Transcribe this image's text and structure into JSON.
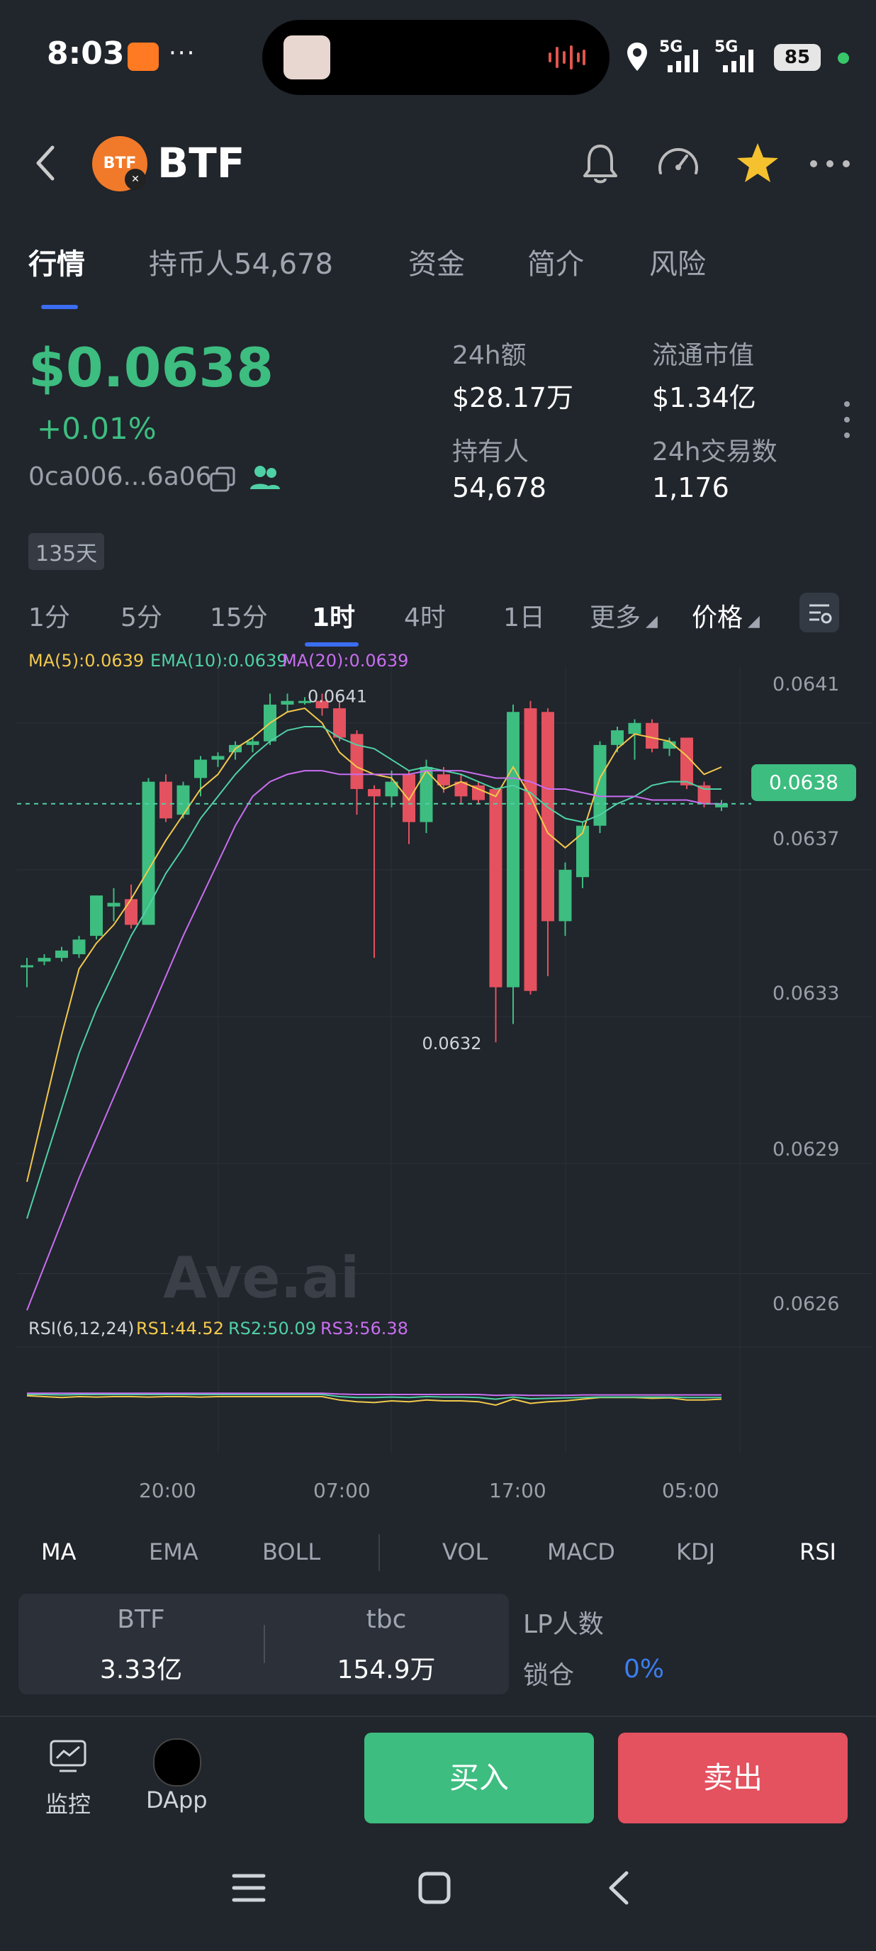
{
  "status_bar": {
    "time": "8:03",
    "battery": "85",
    "network1": "5G",
    "network2": "5G"
  },
  "token": {
    "symbol": "BTF"
  },
  "tabs": [
    {
      "label": "行情",
      "active": true
    },
    {
      "label": "持币人54,678"
    },
    {
      "label": "资金"
    },
    {
      "label": "简介"
    },
    {
      "label": "风险"
    }
  ],
  "price": {
    "value": "$0.0638",
    "change": "+0.01%",
    "address": "0ca006...6a06"
  },
  "stats": {
    "vol24h_label": "24h额",
    "vol24h": "$28.17万",
    "mcap_label": "流通市值",
    "mcap": "$1.34亿",
    "holders_label": "持有人",
    "holders": "54,678",
    "tx24h_label": "24h交易数",
    "tx24h": "1,176"
  },
  "age_badge": "135天",
  "timeframes": [
    "1分",
    "5分",
    "15分",
    "1时",
    "4时",
    "1日"
  ],
  "timeframe_active": "1时",
  "more_label": "更多",
  "price_mode": "价格",
  "ma_legend": {
    "ma5": "MA(5):0.0639",
    "ma10": "EMA(10):0.0639",
    "ma20": "MA(20):0.0639"
  },
  "ma_colors": {
    "ma5": "#f2c94c",
    "ma10": "#4fd1a5",
    "ma20": "#c86ef0"
  },
  "watermark": "Ave.ai",
  "current_price_tag": "0.0638",
  "high_label": "0.0641",
  "low_label": "0.0632",
  "rsi_legend": {
    "name": "RSI(6,12,24)",
    "rs1": "RS1:44.52",
    "rs2": "RS2:50.09",
    "rs3": "RS3:56.38"
  },
  "indicator_tabs": [
    "MA",
    "EMA",
    "BOLL",
    "VOL",
    "MACD",
    "KDJ",
    "RSI"
  ],
  "pool": {
    "token_label": "BTF",
    "token_amount": "3.33亿",
    "quote_label": "tbc",
    "quote_amount": "154.9万",
    "lp_label": "LP人数",
    "lock_label": "锁仓",
    "lock_value": "0%"
  },
  "bottom_nav": {
    "monitor": "监控",
    "dapp": "DApp",
    "buy": "买入",
    "sell": "卖出"
  },
  "chart_data": {
    "type": "candlestick",
    "y_ticks": [
      "0.0641",
      "0.0637",
      "0.0633",
      "0.0629",
      "0.0626"
    ],
    "x_ticks": [
      "20:00",
      "07:00",
      "17:00",
      "05:00"
    ],
    "ylim": [
      0.0624,
      0.0642
    ],
    "candles": [
      {
        "o": 0.06344,
        "h": 0.06346,
        "l": 0.06338,
        "c": 0.06344
      },
      {
        "o": 0.06345,
        "h": 0.06347,
        "l": 0.06344,
        "c": 0.06346
      },
      {
        "o": 0.06346,
        "h": 0.06349,
        "l": 0.06345,
        "c": 0.06348
      },
      {
        "o": 0.06347,
        "h": 0.06352,
        "l": 0.06346,
        "c": 0.06351
      },
      {
        "o": 0.06352,
        "h": 0.06363,
        "l": 0.06351,
        "c": 0.06363
      },
      {
        "o": 0.0636,
        "h": 0.06365,
        "l": 0.06356,
        "c": 0.06361
      },
      {
        "o": 0.06362,
        "h": 0.06366,
        "l": 0.06354,
        "c": 0.06355
      },
      {
        "o": 0.06355,
        "h": 0.06395,
        "l": 0.06355,
        "c": 0.06394
      },
      {
        "o": 0.06394,
        "h": 0.06396,
        "l": 0.06383,
        "c": 0.06384
      },
      {
        "o": 0.06385,
        "h": 0.06394,
        "l": 0.06384,
        "c": 0.06393
      },
      {
        "o": 0.06395,
        "h": 0.06401,
        "l": 0.0639,
        "c": 0.064
      },
      {
        "o": 0.064,
        "h": 0.06402,
        "l": 0.06398,
        "c": 0.06401
      },
      {
        "o": 0.06402,
        "h": 0.06405,
        "l": 0.064,
        "c": 0.06404
      },
      {
        "o": 0.06404,
        "h": 0.06406,
        "l": 0.06402,
        "c": 0.06405
      },
      {
        "o": 0.06405,
        "h": 0.06418,
        "l": 0.06404,
        "c": 0.06415
      },
      {
        "o": 0.06415,
        "h": 0.06418,
        "l": 0.06413,
        "c": 0.06416
      },
      {
        "o": 0.06416,
        "h": 0.06417,
        "l": 0.06415,
        "c": 0.06416
      },
      {
        "o": 0.06416,
        "h": 0.06418,
        "l": 0.06412,
        "c": 0.06414
      },
      {
        "o": 0.06414,
        "h": 0.06416,
        "l": 0.06405,
        "c": 0.06406
      },
      {
        "o": 0.06407,
        "h": 0.06408,
        "l": 0.06385,
        "c": 0.06392
      },
      {
        "o": 0.06392,
        "h": 0.06393,
        "l": 0.06346,
        "c": 0.0639
      },
      {
        "o": 0.0639,
        "h": 0.06397,
        "l": 0.06387,
        "c": 0.06394
      },
      {
        "o": 0.06396,
        "h": 0.06397,
        "l": 0.06377,
        "c": 0.06383
      },
      {
        "o": 0.06383,
        "h": 0.064,
        "l": 0.0638,
        "c": 0.06398
      },
      {
        "o": 0.06396,
        "h": 0.06398,
        "l": 0.06391,
        "c": 0.06393
      },
      {
        "o": 0.06394,
        "h": 0.06396,
        "l": 0.06388,
        "c": 0.0639
      },
      {
        "o": 0.06393,
        "h": 0.06394,
        "l": 0.06388,
        "c": 0.06389
      },
      {
        "o": 0.06392,
        "h": 0.06392,
        "l": 0.06323,
        "c": 0.06338
      },
      {
        "o": 0.06338,
        "h": 0.06415,
        "l": 0.06328,
        "c": 0.06413
      },
      {
        "o": 0.06414,
        "h": 0.06416,
        "l": 0.06336,
        "c": 0.06337
      },
      {
        "o": 0.06413,
        "h": 0.06414,
        "l": 0.06341,
        "c": 0.06356
      },
      {
        "o": 0.06356,
        "h": 0.06372,
        "l": 0.06352,
        "c": 0.0637
      },
      {
        "o": 0.06368,
        "h": 0.06383,
        "l": 0.06365,
        "c": 0.06382
      },
      {
        "o": 0.06382,
        "h": 0.06405,
        "l": 0.0638,
        "c": 0.06404
      },
      {
        "o": 0.06404,
        "h": 0.06409,
        "l": 0.06402,
        "c": 0.06408
      },
      {
        "o": 0.06407,
        "h": 0.06411,
        "l": 0.064,
        "c": 0.0641
      },
      {
        "o": 0.0641,
        "h": 0.06411,
        "l": 0.06402,
        "c": 0.06403
      },
      {
        "o": 0.06403,
        "h": 0.06406,
        "l": 0.06401,
        "c": 0.06405
      },
      {
        "o": 0.06406,
        "h": 0.06406,
        "l": 0.06392,
        "c": 0.06393
      },
      {
        "o": 0.06393,
        "h": 0.06394,
        "l": 0.06387,
        "c": 0.06388
      },
      {
        "o": 0.06387,
        "h": 0.06389,
        "l": 0.06386,
        "c": 0.06388
      }
    ],
    "ma5": [
      0.06285,
      0.06305,
      0.06325,
      0.06343,
      0.0635,
      0.06355,
      0.06362,
      0.0637,
      0.06378,
      0.06385,
      0.06392,
      0.06396,
      0.06403,
      0.06406,
      0.0641,
      0.06413,
      0.06414,
      0.0641,
      0.06402,
      0.06398,
      0.06396,
      0.06395,
      0.06389,
      0.06397,
      0.06392,
      0.06394,
      0.06392,
      0.0639,
      0.06398,
      0.0639,
      0.0638,
      0.06376,
      0.0638,
      0.06395,
      0.06403,
      0.06407,
      0.06406,
      0.06405,
      0.06401,
      0.06396,
      0.06398
    ],
    "ma10": [
      0.06275,
      0.0629,
      0.06305,
      0.0632,
      0.06332,
      0.06342,
      0.06352,
      0.0636,
      0.06369,
      0.06376,
      0.06384,
      0.0639,
      0.06396,
      0.06401,
      0.06405,
      0.06408,
      0.06409,
      0.06409,
      0.06406,
      0.06404,
      0.06403,
      0.064,
      0.06397,
      0.06398,
      0.06397,
      0.06396,
      0.06394,
      0.06392,
      0.06393,
      0.06391,
      0.06387,
      0.06384,
      0.06383,
      0.06385,
      0.06388,
      0.0639,
      0.06393,
      0.06394,
      0.06394,
      0.06392,
      0.06392
    ],
    "ma20": [
      0.0625,
      0.06262,
      0.06274,
      0.06286,
      0.06297,
      0.06308,
      0.06319,
      0.0633,
      0.06341,
      0.06352,
      0.06362,
      0.06372,
      0.06382,
      0.0639,
      0.06394,
      0.06396,
      0.06397,
      0.06397,
      0.06396,
      0.06396,
      0.06396,
      0.06396,
      0.06396,
      0.06397,
      0.06397,
      0.06397,
      0.06396,
      0.06395,
      0.06395,
      0.06394,
      0.06392,
      0.06392,
      0.06391,
      0.0639,
      0.0639,
      0.0639,
      0.06389,
      0.06389,
      0.06389,
      0.06388,
      0.06388
    ]
  }
}
